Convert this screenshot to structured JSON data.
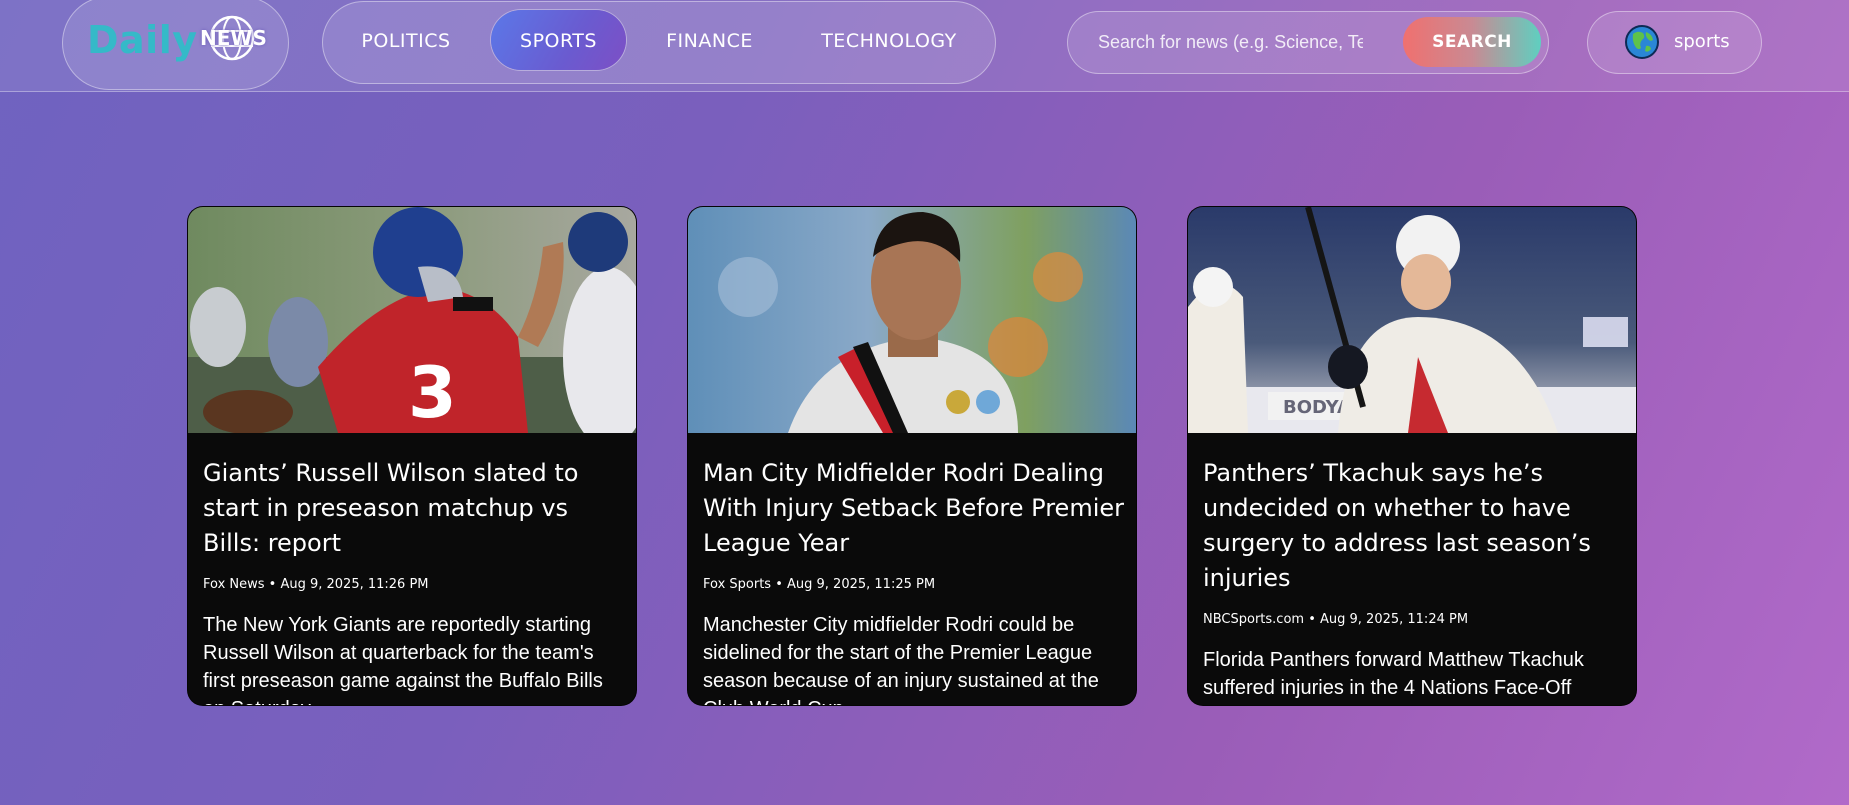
{
  "brand": {
    "daily": "Daily",
    "news": "NEWS"
  },
  "nav": {
    "items": [
      {
        "label": "POLITICS",
        "active": false
      },
      {
        "label": "SPORTS",
        "active": true
      },
      {
        "label": "FINANCE",
        "active": false
      },
      {
        "label": "TECHNOLOGY",
        "active": false
      }
    ]
  },
  "search": {
    "placeholder": "Search for news (e.g. Science, Tech...)",
    "value": "",
    "button_label": "SEARCH"
  },
  "language": {
    "icon": "globe-icon",
    "label": "sports"
  },
  "articles": [
    {
      "title": "Giants’ Russell Wilson slated to start in preseason matchup vs Bills: report",
      "meta": "Fox News • Aug 9, 2025, 11:26 PM",
      "description": "The New York Giants are reportedly starting Russell Wilson at quarterback for the team's first preseason game against the Buffalo Bills on Saturday.",
      "image": "football-quarterback-photo"
    },
    {
      "title": "Man City Midfielder Rodri Dealing With Injury Setback Before Premier League Year",
      "meta": "Fox Sports • Aug 9, 2025, 11:25 PM",
      "description": "Manchester City midfielder Rodri could be sidelined for the start of the Premier League season because of an injury sustained at the Club World Cup.",
      "image": "soccer-player-photo"
    },
    {
      "title": "Panthers’ Tkachuk says he’s undecided on whether to have surgery to address last season’s injuries",
      "meta": "NBCSports.com • Aug 9, 2025, 11:24 PM",
      "description": "Florida Panthers forward Matthew Tkachuk suffered injuries in the 4 Nations Face-Off",
      "image": "hockey-player-photo"
    }
  ],
  "colors": {
    "accent": "#35b9c8",
    "active_tab": "#6a5bd0",
    "card_bg": "#0a0a0a",
    "search_button_start": "#f0706f",
    "search_button_end": "#5fcfc0"
  }
}
